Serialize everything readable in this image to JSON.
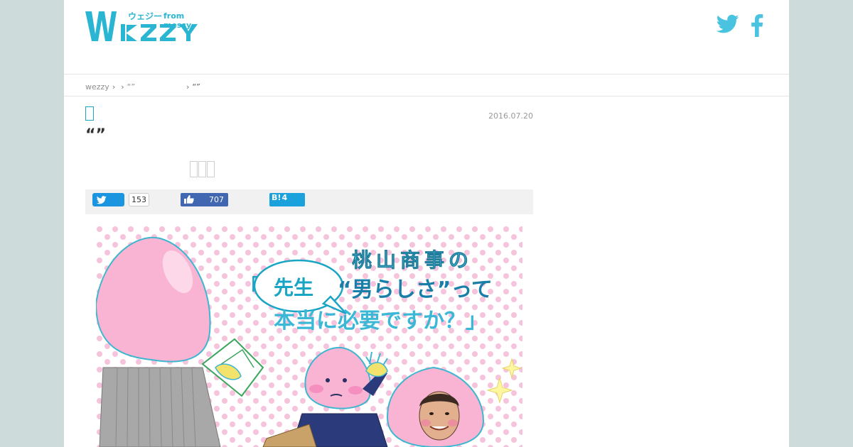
{
  "site": {
    "logo_text": "WEZZY",
    "logo_sub_kana": "ウェジー",
    "logo_sub_from": "from messy",
    "colors": {
      "accent": "#2ab6d2",
      "background": "#cddcdb",
      "tweet": "#1b95e0",
      "like": "#4267b2",
      "hatena": "#1ba1dc"
    }
  },
  "header": {
    "social": [
      {
        "icon": "twitter-icon"
      },
      {
        "icon": "facebook-icon"
      }
    ]
  },
  "breadcrumb": {
    "home": "wezzy",
    "sep": "›",
    "item2": "“”",
    "current": "“”"
  },
  "article": {
    "date": "2016.07.20",
    "title": "“”",
    "category_icon": "category-icon"
  },
  "share": {
    "tweet_count": "153",
    "like_count": "707",
    "hatena_label": "B!",
    "hatena_count": "4"
  },
  "eyecatch": {
    "line1": "桃山商事の",
    "bubble": "先生",
    "line2": "“男らしさ”って",
    "line3": "本当に必要ですか？」",
    "bracket_open": "「"
  }
}
